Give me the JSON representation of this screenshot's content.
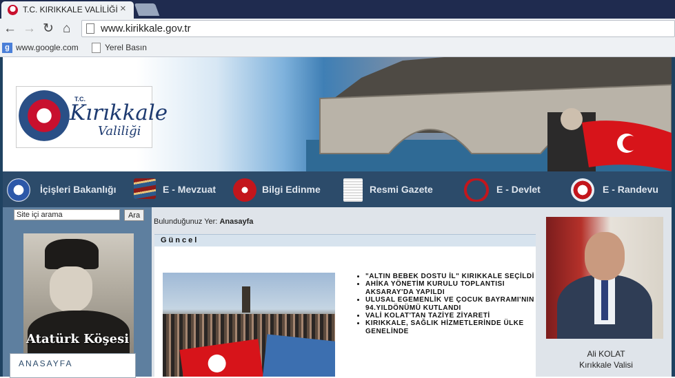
{
  "browser": {
    "tab_title": "T.C. KIRIKKALE VALİLİĞİ",
    "tab_close": "×",
    "url": "www.kirikkale.gov.tr",
    "bookmarks": [
      "www.google.com",
      "Yerel Basın"
    ],
    "icons": {
      "back": "back-arrow-icon",
      "forward": "forward-arrow-icon",
      "reload": "reload-icon",
      "home": "home-icon"
    }
  },
  "header": {
    "logo": {
      "tc": "T.C.",
      "name": "Kırıkkale",
      "sub": "Valiliği"
    }
  },
  "nav": [
    {
      "label": "İçişleri Bakanlığı",
      "icon": "ministry-emblem-icon"
    },
    {
      "label": "E - Mevzuat",
      "icon": "books-icon"
    },
    {
      "label": "Bilgi Edinme",
      "icon": "info-icon"
    },
    {
      "label": "Resmi Gazete",
      "icon": "newspaper-icon"
    },
    {
      "label": "E - Devlet",
      "icon": "edevlet-icon"
    },
    {
      "label": "E - Randevu",
      "icon": "erandevu-icon"
    }
  ],
  "sidebar": {
    "search_value": "Site içi arama",
    "search_button": "Ara",
    "ataturk_caption": "Atatürk Köşesi",
    "menu_item": "ANASAYFA"
  },
  "main": {
    "breadcrumb_prefix": "Bulunduğunuz Yer:",
    "breadcrumb_current": "Anasayfa",
    "section_title": "Güncel",
    "news": [
      "\"ALTIN BEBEK DOSTU İL\" KIRIKKALE SEÇİLDİ",
      "AHİKA YÖNETİM KURULU TOPLANTISI AKSARAY'DA YAPILDI",
      "ULUSAL EGEMENLİK VE ÇOCUK BAYRAMI'NIN 94.YILDÖNÜMÜ KUTLANDI",
      "VALİ KOLAT'TAN TAZİYE ZİYARETİ",
      "KIRIKKALE, SAĞLIK HİZMETLERİNDE ÜLKE GENELİNDE"
    ]
  },
  "governor": {
    "name": "Ali KOLAT",
    "title": "Kırıkkale Valisi"
  },
  "colors": {
    "chrome_dark": "#1f2b4f",
    "chrome_light": "#eef1f4",
    "nav_bg": "#2c4b6a",
    "page_bg": "#1f4261",
    "turkish_red": "#d7141a"
  }
}
